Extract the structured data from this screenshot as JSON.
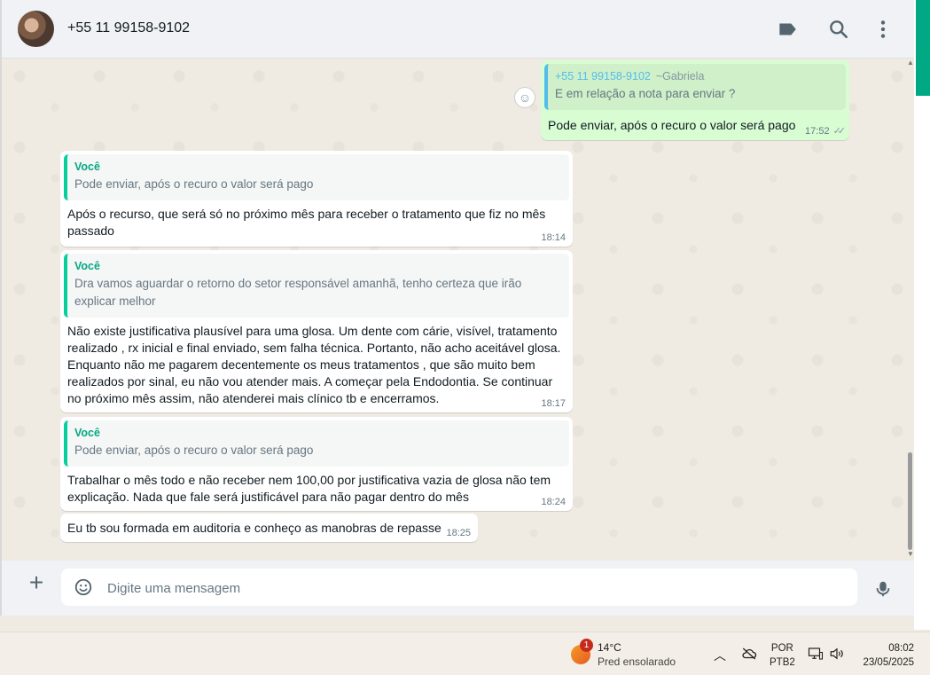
{
  "header": {
    "contact_name": "+55 11 99158-9102",
    "icons": [
      "labels-icon",
      "search-icon",
      "menu-icon"
    ]
  },
  "messages": [
    {
      "direction": "out",
      "quote_author_number": "+55 11 99158-9102",
      "quote_author_alias": "~Gabriela",
      "quote_text": "E em relação a nota para enviar ?",
      "text": "Pode enviar, após o recuro o valor será pago",
      "time": "17:52",
      "status": "read"
    },
    {
      "direction": "in",
      "quote_author": "Você",
      "quote_text": "Pode enviar, após o recuro o valor será pago",
      "text": "Após o recurso,  que será só no próximo mês para receber o tratamento que fiz no mês passado",
      "time": "18:14"
    },
    {
      "direction": "in",
      "quote_author": "Você",
      "quote_text": "Dra vamos aguardar o retorno do setor responsável amanhã, tenho certeza que irão explicar melhor",
      "text": "Não existe justificativa plausível para uma glosa. Um dente com cárie, visível, tratamento realizado , rx inicial e final enviado, sem falha técnica.  Portanto, não acho aceitável glosa. Enquanto não me pagarem decentemente os meus tratamentos , que são muito bem realizados por sinal, eu não vou atender mais. A começar pela Endodontia.  Se continuar no próximo mês assim, não atenderei mais clínico tb e encerramos.",
      "time": "18:17"
    },
    {
      "direction": "in",
      "quote_author": "Você",
      "quote_text": "Pode enviar, após o recuro o valor será pago",
      "text": "Trabalhar o mês todo e não receber nem 100,00 por justificativa vazia de glosa não tem explicação.  Nada que fale será justificável para não pagar dentro do mês",
      "time": "18:24"
    },
    {
      "direction": "in",
      "text": "Eu tb sou formada em auditoria e conheço as manobras de repasse",
      "time": "18:25"
    }
  ],
  "composer": {
    "placeholder": "Digite uma mensagem"
  },
  "taskbar": {
    "weather_badge": "1",
    "temperature": "14°C",
    "weather_desc": "Pred ensolarado",
    "lang_top": "POR",
    "lang_bottom": "PTB2",
    "time": "08:02",
    "date": "23/05/2025"
  },
  "colors": {
    "accent": "#00a884",
    "outgoing_bubble": "#d9fdd3",
    "incoming_bubble": "#ffffff",
    "quote_bar_self": "#06cf9c",
    "quote_bar_other": "#53bdeb"
  }
}
